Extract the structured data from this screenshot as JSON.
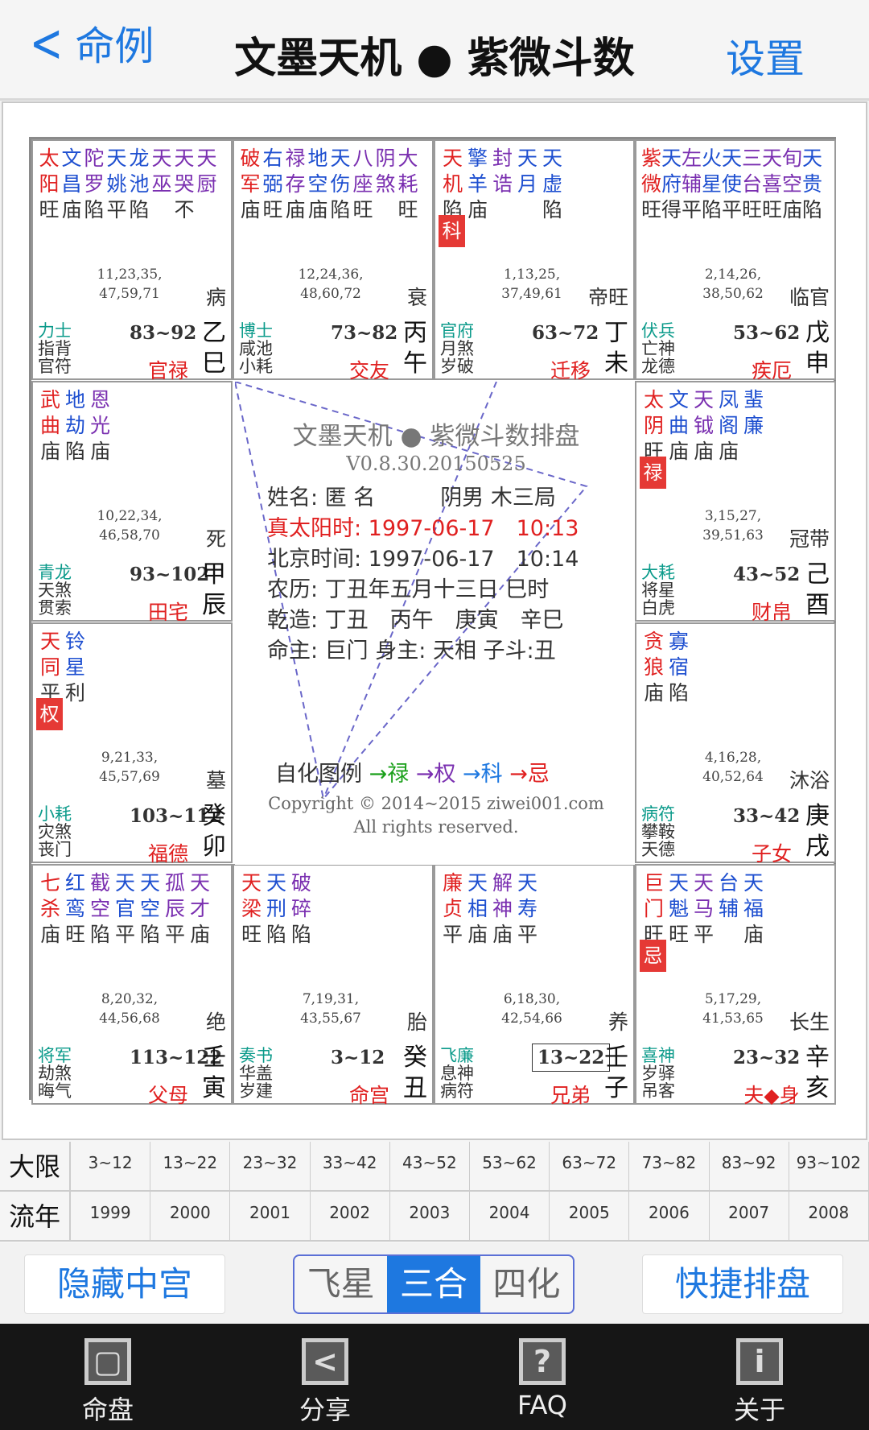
{
  "header": {
    "back_label": "命例",
    "title": "文墨天机 ● 紫微斗数",
    "settings_label": "设置"
  },
  "palaces": {
    "si": {
      "s1": "太文陀天龙天天天",
      "s2": "阳昌罗姚池巫哭厨",
      "s3": "旺庙陷平陷　不",
      "mark": "",
      "nums1": "11,23,35,",
      "nums2": "47,59,71",
      "phase": "病",
      "god1": "力士",
      "god2": "指背",
      "god3": "官符",
      "age": "83~92",
      "palace": "官禄",
      "stem": "乙",
      "branch": "巳"
    },
    "wu": {
      "s1": "破右禄地天八阴大",
      "s2": "军弼存空伤座煞耗",
      "s3": "庙旺庙庙陷旺　旺",
      "mark": "",
      "nums1": "12,24,36,",
      "nums2": "48,60,72",
      "phase": "衰",
      "god1": "博士",
      "god2": "咸池",
      "god3": "小耗",
      "age": "73~82",
      "palace": "交友",
      "stem": "丙",
      "branch": "午"
    },
    "wei": {
      "s1": "天擎封天天",
      "s2": "机羊诰月虚",
      "s3": "陷庙　　陷",
      "mark": "科",
      "nums1": "1,13,25,",
      "nums2": "37,49,61",
      "phase": "帝旺",
      "god1": "官府",
      "god2": "月煞",
      "god3": "岁破",
      "age": "63~72",
      "palace": "迁移",
      "stem": "丁",
      "branch": "未"
    },
    "shen": {
      "s1": "紫天左火天三天旬天",
      "s2": "微府辅星使台喜空贵",
      "s3": "旺得平陷平旺旺庙陷",
      "mark": "",
      "nums1": "2,14,26,",
      "nums2": "38,50,62",
      "phase": "临官",
      "god1": "伏兵",
      "god2": "亡神",
      "god3": "龙德",
      "age": "53~62",
      "palace": "疾厄",
      "stem": "戊",
      "branch": "申"
    },
    "chen": {
      "s1": "武地恩",
      "s2": "曲劫光",
      "s3": "庙陷庙",
      "mark": "",
      "nums1": "10,22,34,",
      "nums2": "46,58,70",
      "phase": "死",
      "god1": "青龙",
      "god2": "天煞",
      "god3": "贯索",
      "age": "93~102",
      "palace": "田宅",
      "stem": "甲",
      "branch": "辰"
    },
    "you": {
      "s1": "太文天凤蜚",
      "s2": "阴曲钺阁廉",
      "s3": "旺庙庙庙",
      "mark": "禄",
      "nums1": "3,15,27,",
      "nums2": "39,51,63",
      "phase": "冠带",
      "god1": "大耗",
      "god2": "将星",
      "god3": "白虎",
      "age": "43~52",
      "palace": "财帛",
      "stem": "己",
      "branch": "酉"
    },
    "mao": {
      "s1": "天铃",
      "s2": "同星",
      "s3": "平利",
      "mark": "权",
      "nums1": "9,21,33,",
      "nums2": "45,57,69",
      "phase": "墓",
      "god1": "小耗",
      "god2": "灾煞",
      "god3": "丧门",
      "age": "103~112",
      "palace": "福德",
      "stem": "癸",
      "branch": "卯"
    },
    "xu": {
      "s1": "贪寡",
      "s2": "狼宿",
      "s3": "庙陷",
      "mark": "",
      "nums1": "4,16,28,",
      "nums2": "40,52,64",
      "phase": "沐浴",
      "god1": "病符",
      "god2": "攀鞍",
      "god3": "天德",
      "age": "33~42",
      "palace": "子女",
      "stem": "庚",
      "branch": "戌"
    },
    "yin": {
      "s1": "七红截天天孤天",
      "s2": "杀鸾空官空辰才",
      "s3": "庙旺陷平陷平庙",
      "mark": "",
      "nums1": "8,20,32,",
      "nums2": "44,56,68",
      "phase": "绝",
      "god1": "将军",
      "god2": "劫煞",
      "god3": "晦气",
      "age": "113~122",
      "palace": "父母",
      "stem": "壬",
      "branch": "寅"
    },
    "chou": {
      "s1": "天天破",
      "s2": "梁刑碎",
      "s3": "旺陷陷",
      "mark": "",
      "nums1": "7,19,31,",
      "nums2": "43,55,67",
      "phase": "胎",
      "god1": "奏书",
      "god2": "华盖",
      "god3": "岁建",
      "age": "3~12",
      "palace": "命宫",
      "stem": "癸",
      "branch": "丑"
    },
    "zi": {
      "s1": "廉天解天",
      "s2": "贞相神寿",
      "s3": "平庙庙平",
      "mark": "",
      "nums1": "6,18,30,",
      "nums2": "42,54,66",
      "phase": "养",
      "god1": "飞廉",
      "god2": "息神",
      "god3": "病符",
      "age": "13~22",
      "palace": "兄弟",
      "stem": "壬",
      "branch": "子"
    },
    "hai": {
      "s1": "巨天天台天",
      "s2": "门魁马辅福",
      "s3": "旺旺平　庙",
      "mark": "忌",
      "nums1": "5,17,29,",
      "nums2": "41,53,65",
      "phase": "长生",
      "god1": "喜神",
      "god2": "岁驿",
      "god3": "吊客",
      "age": "23~32",
      "palace": "夫◆身",
      "stem": "辛",
      "branch": "亥"
    }
  },
  "center": {
    "title": "文墨天机 ● 紫微斗数排盘",
    "version": "V0.8.30.20150525",
    "line1": "姓名: 匿 名　　　阴男 木三局",
    "line2": "真太阳时: 1997-06-17　10:13",
    "line3": "北京时间: 1997-06-17　10:14",
    "line4": "农历: 丁丑年五月十三日 巳时",
    "line5": "乾造: 丁丑　丙午　庚寅　辛巳",
    "line6": "命主: 巨门 身主: 天相 子斗:丑",
    "legend_label": "自化图例",
    "legend_lu": "→禄",
    "legend_quan": "→权",
    "legend_ke": "→科",
    "legend_ji": "→忌",
    "copy1": "Copyright © 2014~2015 ziwei001.com",
    "copy2": "All rights reserved."
  },
  "table": {
    "daxian_label": "大限",
    "liunian_label": "流年",
    "daxian": [
      "3~12",
      "13~22",
      "23~32",
      "33~42",
      "43~52",
      "53~62",
      "63~72",
      "73~82",
      "83~92",
      "93~102"
    ],
    "liunian": [
      "1999",
      "2000",
      "2001",
      "2002",
      "2003",
      "2004",
      "2005",
      "2006",
      "2007",
      "2008"
    ]
  },
  "buttons": {
    "hide": "隐藏中宫",
    "fly": "飞星",
    "sanhe": "三合",
    "sihua": "四化",
    "quick": "快捷排盘"
  },
  "nav": {
    "chart": "命盘",
    "share": "分享",
    "faq": "FAQ",
    "about": "关于"
  },
  "colors": {
    "accent": "#1e78e0",
    "red": "#e02020",
    "green": "#0a9a8a"
  }
}
